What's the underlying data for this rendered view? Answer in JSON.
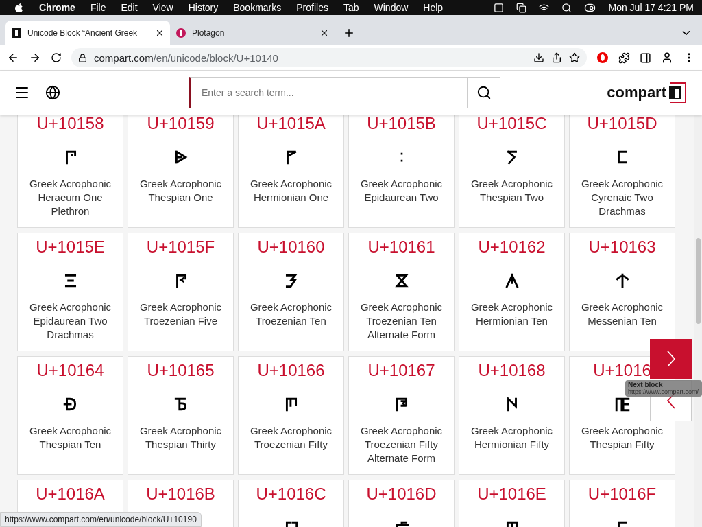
{
  "menubar": {
    "app": "Chrome",
    "items": [
      "File",
      "Edit",
      "View",
      "History",
      "Bookmarks",
      "Profiles",
      "Tab",
      "Window",
      "Help"
    ],
    "clock": "Mon Jul 17  4:21 PM"
  },
  "tabs": [
    {
      "title": "Unicode Block “Ancient Greek",
      "selected": true
    },
    {
      "title": "Plotagon",
      "selected": false
    }
  ],
  "address": {
    "host": "compart.com",
    "path": "/en/unicode/block/U+10140"
  },
  "header": {
    "search_placeholder": "Enter a search term...",
    "logo": "compart"
  },
  "cells": [
    {
      "code": "U+10158",
      "name": "Greek Acrophonic Heraeum One Plethron"
    },
    {
      "code": "U+10159",
      "name": "Greek Acrophonic Thespian One"
    },
    {
      "code": "U+1015A",
      "name": "Greek Acrophonic Hermionian One"
    },
    {
      "code": "U+1015B",
      "name": "Greek Acrophonic Epidaurean Two"
    },
    {
      "code": "U+1015C",
      "name": "Greek Acrophonic Thespian Two"
    },
    {
      "code": "U+1015D",
      "name": "Greek Acrophonic Cyrenaic Two Drachmas"
    },
    {
      "code": "U+1015E",
      "name": "Greek Acrophonic Epidaurean Two Drachmas"
    },
    {
      "code": "U+1015F",
      "name": "Greek Acrophonic Troezenian Five"
    },
    {
      "code": "U+10160",
      "name": "Greek Acrophonic Troezenian Ten"
    },
    {
      "code": "U+10161",
      "name": "Greek Acrophonic Troezenian Ten Alternate Form"
    },
    {
      "code": "U+10162",
      "name": "Greek Acrophonic Hermionian Ten"
    },
    {
      "code": "U+10163",
      "name": "Greek Acrophonic Messenian Ten"
    },
    {
      "code": "U+10164",
      "name": "Greek Acrophonic Thespian Ten"
    },
    {
      "code": "U+10165",
      "name": "Greek Acrophonic Thespian Thirty"
    },
    {
      "code": "U+10166",
      "name": "Greek Acrophonic Troezenian Fifty"
    },
    {
      "code": "U+10167",
      "name": "Greek Acrophonic Troezenian Fifty Alternate Form"
    },
    {
      "code": "U+10168",
      "name": "Greek Acrophonic Hermionian Fifty"
    },
    {
      "code": "U+1016",
      "name": "Greek Acrophonic Thespian Fifty"
    },
    {
      "code": "U+1016A"
    },
    {
      "code": "U+1016B"
    },
    {
      "code": "U+1016C"
    },
    {
      "code": "U+1016D"
    },
    {
      "code": "U+1016E"
    },
    {
      "code": "U+1016F"
    }
  ],
  "tooltip": {
    "title": "Next block",
    "url": "https://www.compart.com/"
  },
  "status_url": "https://www.compart.com/en/unicode/block/U+10190"
}
